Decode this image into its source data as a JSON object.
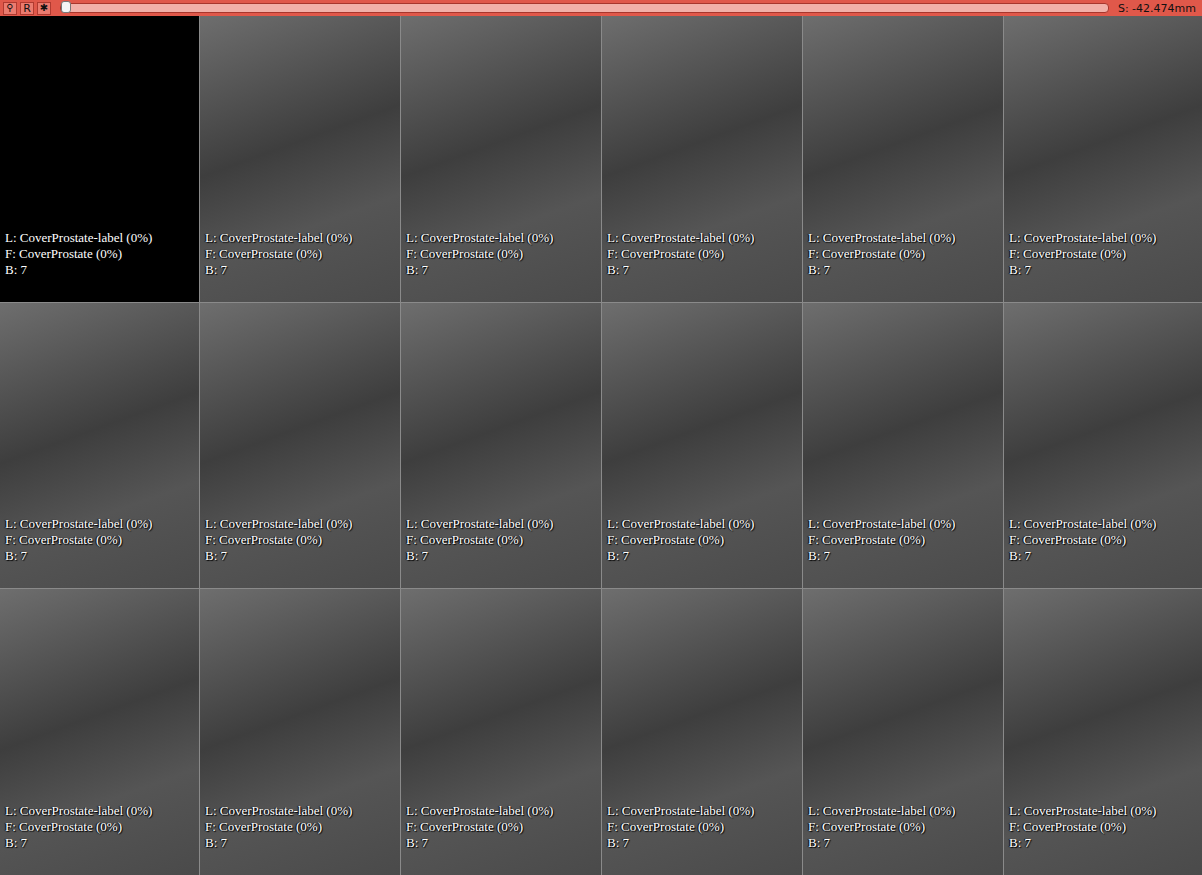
{
  "toolbar": {
    "pin": "⚲",
    "orientation": "R",
    "link": "✱",
    "slider": {
      "level": 0.0
    },
    "offset": "S: -42.474mm"
  },
  "tiles": [
    {
      "kind": "blank",
      "lines": [
        "L: CoverProstate-label (0%)",
        "F: CoverProstate (0%)",
        "B: 7"
      ]
    },
    {
      "kind": "image",
      "lines": [
        "L: CoverProstate-label (0%)",
        "F: CoverProstate (0%)",
        "B: 7"
      ]
    },
    {
      "kind": "image",
      "lines": [
        "L: CoverProstate-label (0%)",
        "F: CoverProstate (0%)",
        "B: 7"
      ]
    },
    {
      "kind": "image",
      "lines": [
        "L: CoverProstate-label (0%)",
        "F: CoverProstate (0%)",
        "B: 7"
      ]
    },
    {
      "kind": "image",
      "lines": [
        "L: CoverProstate-label (0%)",
        "F: CoverProstate (0%)",
        "B: 7"
      ]
    },
    {
      "kind": "image",
      "lines": [
        "L: CoverProstate-label (0%)",
        "F: CoverProstate (0%)",
        "B: 7"
      ]
    },
    {
      "kind": "image",
      "lines": [
        "L: CoverProstate-label (0%)",
        "F: CoverProstate (0%)",
        "B: 7"
      ]
    },
    {
      "kind": "image",
      "lines": [
        "L: CoverProstate-label (0%)",
        "F: CoverProstate (0%)",
        "B: 7"
      ]
    },
    {
      "kind": "image",
      "lines": [
        "L: CoverProstate-label (0%)",
        "F: CoverProstate (0%)",
        "B: 7"
      ]
    },
    {
      "kind": "image",
      "lines": [
        "L: CoverProstate-label (0%)",
        "F: CoverProstate (0%)",
        "B: 7"
      ]
    },
    {
      "kind": "image",
      "lines": [
        "L: CoverProstate-label (0%)",
        "F: CoverProstate (0%)",
        "B: 7"
      ]
    },
    {
      "kind": "image",
      "lines": [
        "L: CoverProstate-label (0%)",
        "F: CoverProstate (0%)",
        "B: 7"
      ]
    },
    {
      "kind": "image",
      "lines": [
        "L: CoverProstate-label (0%)",
        "F: CoverProstate (0%)",
        "B: 7"
      ]
    },
    {
      "kind": "image",
      "lines": [
        "L: CoverProstate-label (0%)",
        "F: CoverProstate (0%)",
        "B: 7"
      ]
    },
    {
      "kind": "image",
      "lines": [
        "L: CoverProstate-label (0%)",
        "F: CoverProstate (0%)",
        "B: 7"
      ]
    },
    {
      "kind": "image",
      "lines": [
        "L: CoverProstate-label (0%)",
        "F: CoverProstate (0%)",
        "B: 7"
      ]
    },
    {
      "kind": "image",
      "lines": [
        "L: CoverProstate-label (0%)",
        "F: CoverProstate (0%)",
        "B: 7"
      ]
    },
    {
      "kind": "image",
      "lines": [
        "L: CoverProstate-label (0%)",
        "F: CoverProstate (0%)",
        "B: 7"
      ]
    }
  ]
}
